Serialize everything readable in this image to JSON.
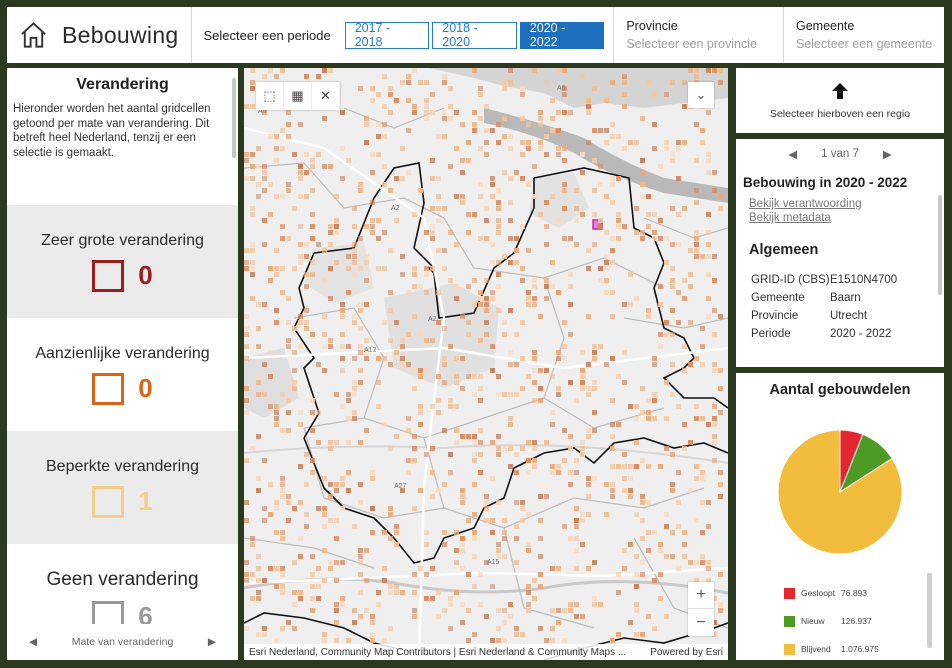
{
  "header": {
    "title": "Bebouwing",
    "period_label": "Selecteer een periode",
    "periods": [
      "2017 - 2018",
      "2018 - 2020",
      "2020 - 2022"
    ],
    "active_period": "2020 - 2022",
    "province": {
      "label": "Provincie",
      "placeholder": "Selecteer een provincie"
    },
    "municipality": {
      "label": "Gemeente",
      "placeholder": "Selecteer een gemeente"
    }
  },
  "left": {
    "title": "Verandering",
    "description": "Hieronder worden het aantal gridcellen getoond per mate van verandering. Dit betreft heel Nederland, tenzij er een selectie is gemaakt.",
    "categories": [
      {
        "label": "Zeer grote verandering",
        "count": "0",
        "color": "#9b1c1c"
      },
      {
        "label": "Aanzienlijke verandering",
        "count": "0",
        "color": "#d9641c"
      },
      {
        "label": "Beperkte verandering",
        "count": "1",
        "color": "#f5cd8a"
      },
      {
        "label": "Geen verandering",
        "count": "6",
        "color": "#999999"
      }
    ],
    "footer": "Mate van verandering"
  },
  "map": {
    "attribution": "Esri Nederland, Community Map Contributors | Esri Nederland & Community Maps ...",
    "powered_by": "Powered by Esri",
    "road_labels": [
      "A5",
      "A6",
      "A2",
      "A2",
      "A12",
      "A27",
      "A15"
    ],
    "zoom_in": "+",
    "zoom_out": "−"
  },
  "region": {
    "text": "Selecteer hierboven een regio"
  },
  "popup": {
    "pager": "1 van 7",
    "title": "Bebouwing in 2020 - 2022",
    "links": [
      "Bekijk verantwoording",
      "Bekijk metadata"
    ],
    "section": "Algemeen",
    "attributes": [
      {
        "key": "GRID-ID (CBS)",
        "value": "E1510N4700"
      },
      {
        "key": "Gemeente",
        "value": "Baarn"
      },
      {
        "key": "Provincie",
        "value": "Utrecht"
      },
      {
        "key": "Periode",
        "value": "2020 - 2022"
      }
    ]
  },
  "chart_data": {
    "type": "pie",
    "title": "Aantal gebouwdelen",
    "slices": [
      {
        "name": "Gesloopt",
        "value": 76893,
        "label": "76.893",
        "color": "#e3262f"
      },
      {
        "name": "Nieuw",
        "value": 126937,
        "label": "126.937",
        "color": "#4d9a24"
      },
      {
        "name": "Blijvend",
        "value": 1076975,
        "label": "1.076.975",
        "color": "#f2bd3d"
      }
    ],
    "legend_position": "bottom-left"
  }
}
